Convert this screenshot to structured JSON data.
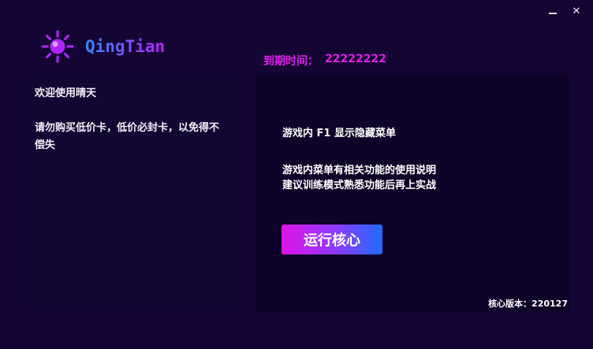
{
  "window": {
    "minimize_icon": "minimize-icon",
    "close_icon": "close-icon",
    "close_glyph": "✕"
  },
  "brand": {
    "name": "QingTian",
    "logo_icon": "sun-icon",
    "colors": {
      "sun": "#b026ff",
      "text_start": "#2b8cff",
      "text_end": "#c21cff"
    }
  },
  "expiry": {
    "label": "到期时间：",
    "value": "22222222"
  },
  "left_panel": {
    "welcome": "欢迎使用晴天",
    "warning": "请勿购买低价卡，低价必封卡，以免得不偿失"
  },
  "right_panel": {
    "tip_line1": "游戏内 F1 显示隐藏菜单",
    "tip_line2": "游戏内菜单有相关功能的使用说明",
    "tip_line3": "建议训练模式熟悉功能后再上实战",
    "run_button": "运行核心"
  },
  "version": {
    "text": "核心版本：220127"
  },
  "colors": {
    "background": "#150535",
    "accent_magenta": "#e020e6",
    "accent_blue": "#1f6bff"
  }
}
